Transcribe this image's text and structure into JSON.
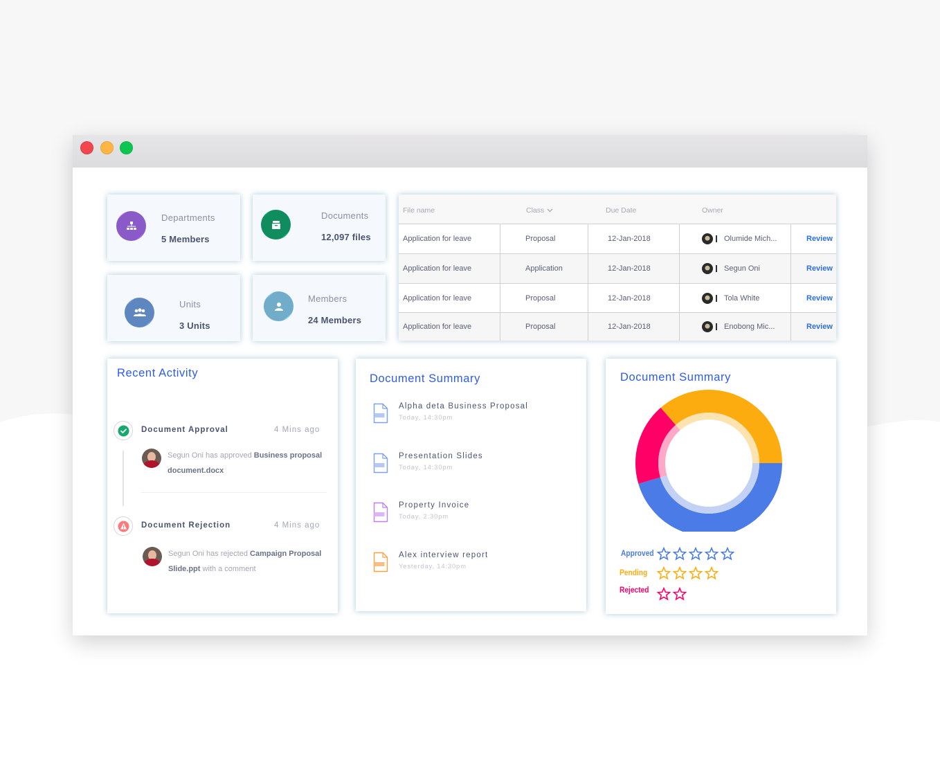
{
  "window": {
    "controls": [
      "close",
      "minimize",
      "maximize"
    ]
  },
  "stats": [
    {
      "label": "Departments",
      "value": "5 Members",
      "icon": "org-chart-icon",
      "color": "#a56cf0"
    },
    {
      "label": "Documents",
      "value": "12,097 files",
      "icon": "archive-box-icon",
      "color": "#10a870"
    },
    {
      "label": "Units",
      "value": "3 Units",
      "icon": "group-icon",
      "color": "#6f9ee0"
    },
    {
      "label": "Members",
      "value": "24 Members",
      "icon": "user-icon",
      "color": "#7fcdf5"
    }
  ],
  "table": {
    "headers": {
      "file": "File name",
      "class": "Class",
      "due": "Due Date",
      "owner": "Owner"
    },
    "rows": [
      {
        "file": "Application for leave",
        "class": "Proposal",
        "due": "12-Jan-2018",
        "owner": "Olumide Mich...",
        "action": "Review"
      },
      {
        "file": "Application for leave",
        "class": "Application",
        "due": "12-Jan-2018",
        "owner": "Segun Oni",
        "action": "Review"
      },
      {
        "file": "Application for leave",
        "class": "Proposal",
        "due": "12-Jan-2018",
        "owner": "Tola White",
        "action": "Review"
      },
      {
        "file": "Application for leave",
        "class": "Proposal",
        "due": "12-Jan-2018",
        "owner": "Enobong Mic...",
        "action": "Review"
      }
    ]
  },
  "recent_activity": {
    "title": "Recent Activity",
    "items": [
      {
        "title": "Document Approval",
        "time": "4 Mins ago",
        "status": "approved",
        "text_pre": "Segun Oni has approved ",
        "text_bold": "Business proposal document.docx",
        "text_post": ""
      },
      {
        "title": "Document Rejection",
        "time": "4 Mins ago",
        "status": "rejected",
        "text_pre": "Segun Oni has rejected ",
        "text_bold": "Campaign Proposal Slide.ppt",
        "text_post": " with a comment"
      }
    ]
  },
  "document_list": {
    "title": "Document Summary",
    "items": [
      {
        "name": "Alpha deta Business Proposal",
        "time": "Today, 14:30pm",
        "color": "#7b9ff0",
        "fill": "#b4c8f7"
      },
      {
        "name": "Presentation Slides",
        "time": "Today, 14:30pm",
        "color": "#7b9ff0",
        "fill": "#b4c8f7"
      },
      {
        "name": "Property Invoice",
        "time": "Today, 2:30pm",
        "color": "#c07df0",
        "fill": "#dcb6f7"
      },
      {
        "name": "Alex interview report",
        "time": "Yesterday, 14:30pm",
        "color": "#f7a23e",
        "fill": "#f7bf86"
      }
    ]
  },
  "chart_data": {
    "type": "pie",
    "title": "Document Summary",
    "donut": true,
    "categories": [
      "Approved",
      "Pending",
      "Rejected"
    ],
    "values": [
      5,
      4,
      2
    ],
    "colors": [
      "#4a7be6",
      "#fdac10",
      "#ff0066"
    ],
    "inner_colors": [
      "#c3d1f5",
      "#fde3b0",
      "#ffa8c8"
    ],
    "legend": [
      {
        "label": "Approved",
        "stars": 5,
        "color": "#4a7be6"
      },
      {
        "label": "Pending",
        "stars": 4,
        "color": "#fdac10"
      },
      {
        "label": "Rejected",
        "stars": 2,
        "color": "#ff0066"
      }
    ],
    "legend_position": "bottom-left"
  }
}
